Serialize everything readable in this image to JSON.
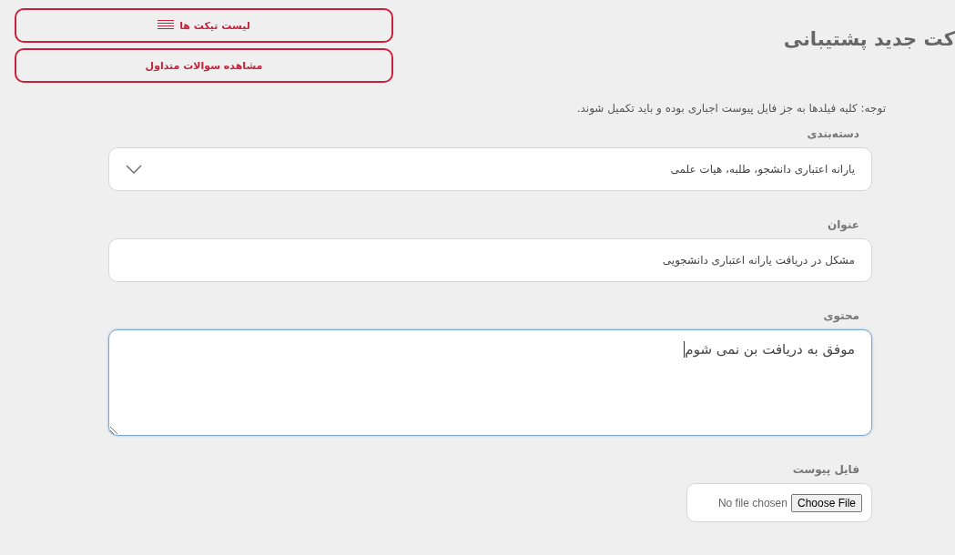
{
  "top_buttons": [
    {
      "kind": "list",
      "label": "لیست تیکت ها"
    },
    {
      "kind": "plain",
      "label": "مشاهده سوالات متداول"
    }
  ],
  "page_title": "کت جدید پشتیبانی",
  "notice": "توجه: کلیه فیلدها به جز فایل پیوست اجباری بوده و باید تکمیل شوند.",
  "fields": [
    {
      "kind": "select",
      "label": "دسته‌بندی",
      "value": "یارانه اعتباری دانشجو، طلبه، هیات علمی"
    },
    {
      "kind": "text",
      "label": "عنوان",
      "value": "مشکل در دریافت یارانه اعتباری دانشجویی"
    },
    {
      "kind": "textarea",
      "label": "محتوی",
      "value": "موفق به دریافت بن نمی شوم",
      "focused": true
    },
    {
      "kind": "file",
      "label": "فایل پیوست",
      "status": "No file chosen",
      "button": "Choose File"
    }
  ]
}
